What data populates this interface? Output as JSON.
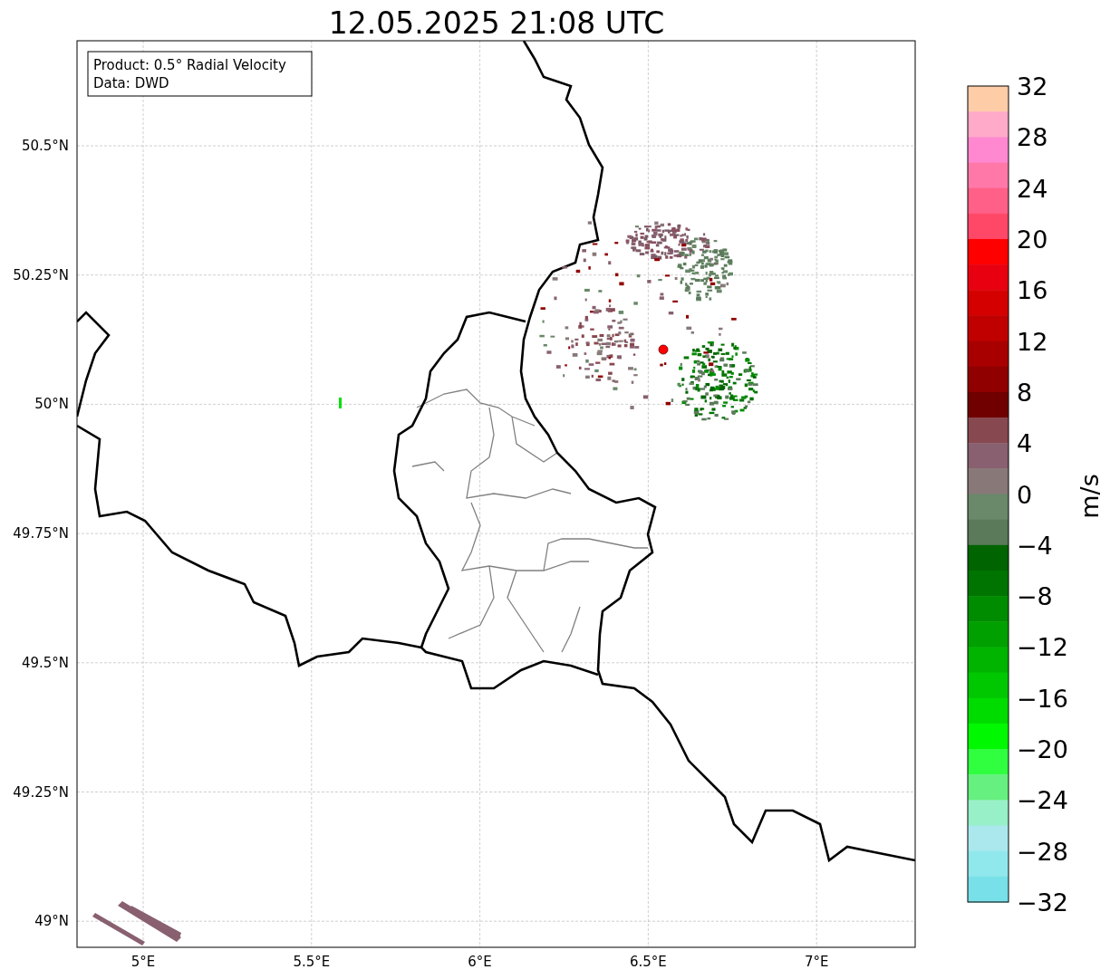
{
  "title": "12.05.2025 21:08 UTC",
  "info_box": [
    "Product: 0.5° Radial Velocity",
    "Data: DWD"
  ],
  "y_ticks": [
    "50.5°N",
    "50.25°N",
    "50°N",
    "49.75°N",
    "49.5°N",
    "49.25°N",
    "49°N"
  ],
  "x_ticks": [
    "5°E",
    "5.5°E",
    "6°E",
    "6.5°E",
    "7°E"
  ],
  "colorbar": {
    "label": "m/s",
    "ticks": [
      "32",
      "28",
      "24",
      "20",
      "16",
      "12",
      "8",
      "4",
      "0",
      "−4",
      "−8",
      "−12",
      "−16",
      "−20",
      "−24",
      "−28",
      "−32"
    ],
    "bands": [
      {
        "color": "#ffcca8"
      },
      {
        "color": "#ffaac8"
      },
      {
        "color": "#ff88d0"
      },
      {
        "color": "#ff78a8"
      },
      {
        "color": "#ff6088"
      },
      {
        "color": "#ff4868"
      },
      {
        "color": "#ff0000"
      },
      {
        "color": "#e80010"
      },
      {
        "color": "#d40000"
      },
      {
        "color": "#c00000"
      },
      {
        "color": "#a80000"
      },
      {
        "color": "#900000"
      },
      {
        "color": "#700000"
      },
      {
        "color": "#884850"
      },
      {
        "color": "#886070"
      },
      {
        "color": "#887878"
      },
      {
        "color": "#6a886a"
      },
      {
        "color": "#5a7a5a"
      },
      {
        "color": "#006400"
      },
      {
        "color": "#007400"
      },
      {
        "color": "#008c00"
      },
      {
        "color": "#00a000"
      },
      {
        "color": "#00b400"
      },
      {
        "color": "#00c800"
      },
      {
        "color": "#00dc00"
      },
      {
        "color": "#00f800"
      },
      {
        "color": "#30ff40"
      },
      {
        "color": "#66f080"
      },
      {
        "color": "#98f0c8"
      },
      {
        "color": "#aae8ee"
      },
      {
        "color": "#90e8ec"
      },
      {
        "color": "#78e0e8"
      }
    ]
  }
}
